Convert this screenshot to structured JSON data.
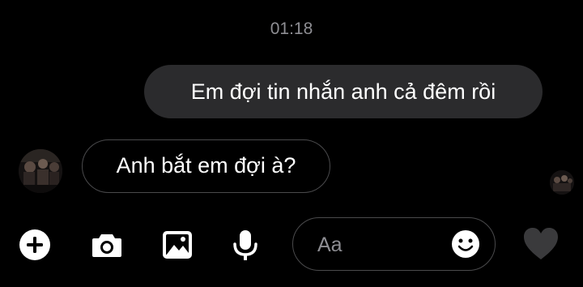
{
  "thread": {
    "timestamp": "01:18",
    "messages": [
      {
        "direction": "outgoing",
        "text": "Em đợi tin nhắn anh cả đêm rồi"
      },
      {
        "direction": "incoming",
        "text": "Anh bắt em đợi à?"
      }
    ]
  },
  "composer": {
    "placeholder": "Aa",
    "toolbar_icons": [
      "plus-icon",
      "camera-icon",
      "image-icon",
      "microphone-icon"
    ],
    "emoji_icon": "smile-icon",
    "like_icon": "heart-icon"
  },
  "colors": {
    "background": "#000000",
    "outgoing_bubble": "#2b2b2d",
    "incoming_border": "#4a4a4c",
    "text": "#ffffff",
    "muted": "#8e8e93",
    "heart": "#3a3a3c"
  }
}
